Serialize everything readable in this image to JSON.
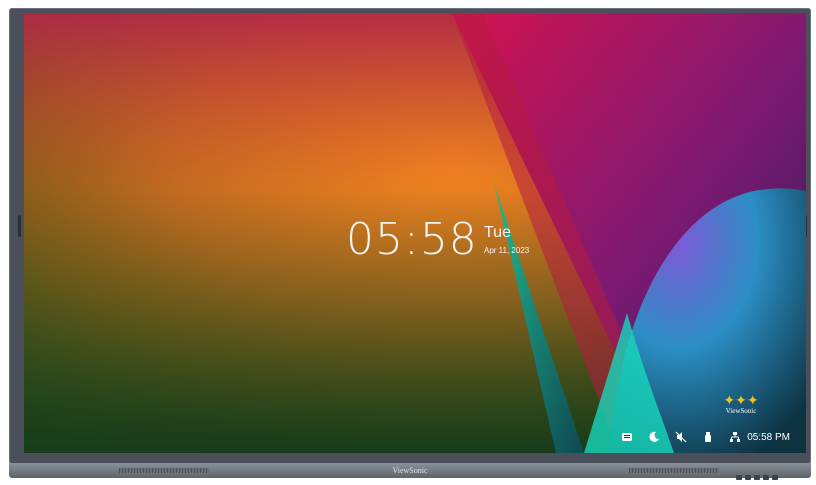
{
  "display": {
    "brand": "ViewSonic",
    "clock": {
      "time": "05:58",
      "day": "Tue",
      "date": "Apr 11, 2023"
    },
    "taskbar": {
      "time": "05:58 PM",
      "icons": [
        "keyboard-icon",
        "moon-icon",
        "mute-icon",
        "usb-icon",
        "network-icon"
      ]
    },
    "logo": {
      "word": "ViewSonic"
    },
    "colors": {
      "bezel": "#4a4f5a",
      "accent_red": "#d4134f",
      "accent_teal": "#16b8b0",
      "accent_orange": "#f08320"
    }
  }
}
